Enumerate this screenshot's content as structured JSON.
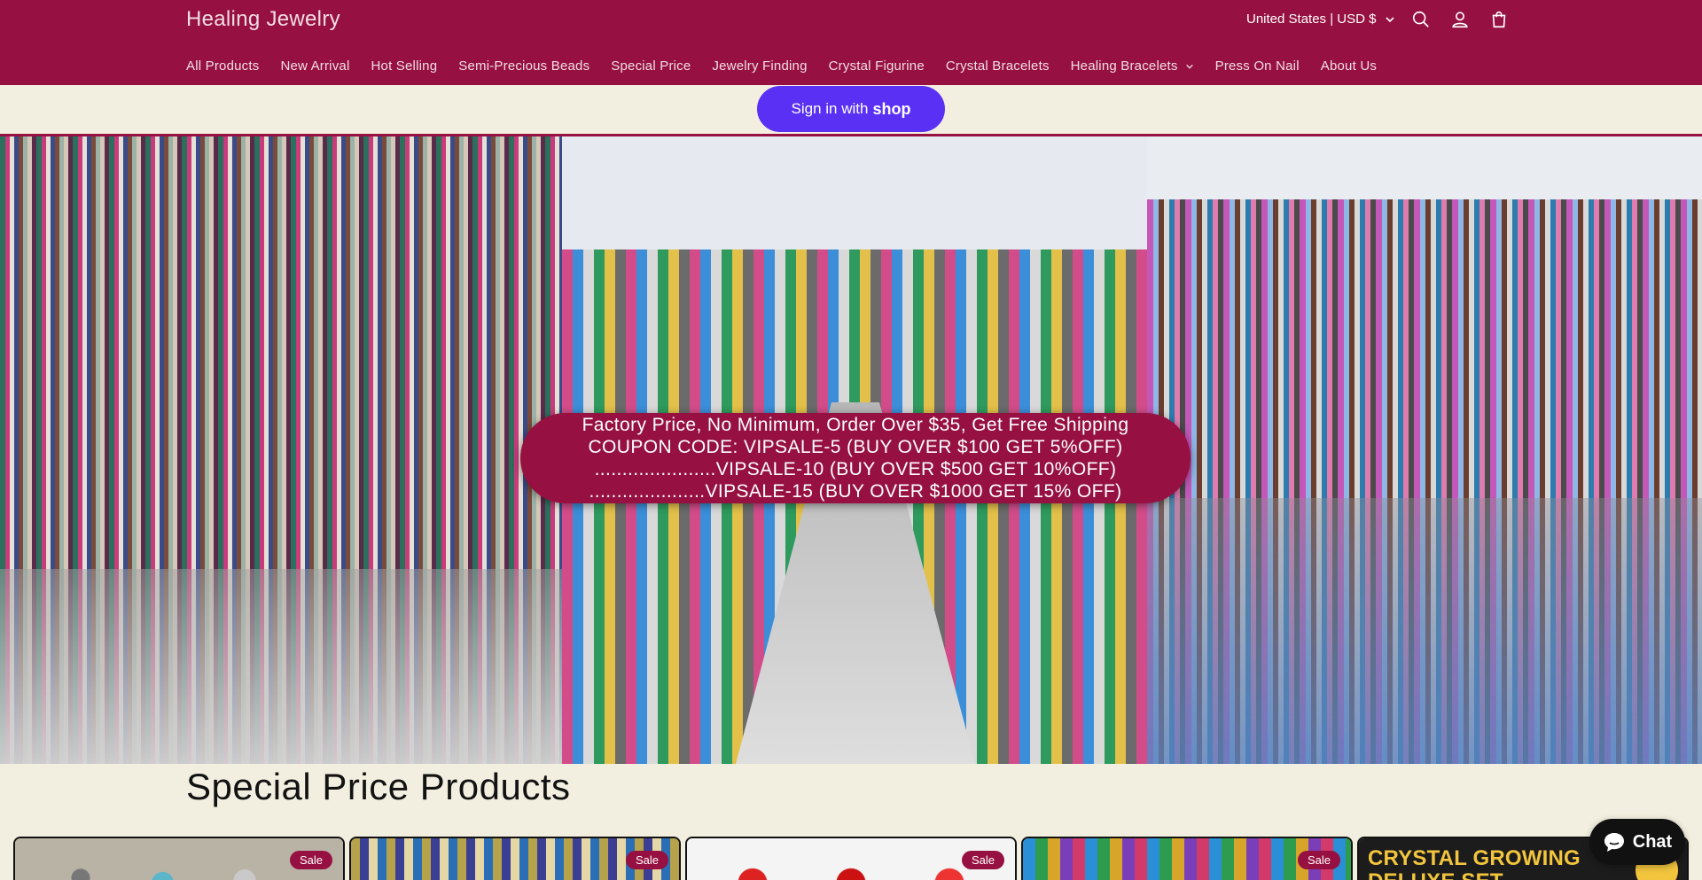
{
  "header": {
    "logo": "Healing Jewelry",
    "country": "United States | USD $",
    "icons": [
      "search-icon",
      "account-icon",
      "cart-icon"
    ],
    "brand_color": "#961142"
  },
  "nav": {
    "items": [
      {
        "label": "All Products"
      },
      {
        "label": "New Arrival"
      },
      {
        "label": "Hot Selling"
      },
      {
        "label": "Semi-Precious Beads"
      },
      {
        "label": "Special Price"
      },
      {
        "label": "Jewelry Finding"
      },
      {
        "label": "Crystal Figurine"
      },
      {
        "label": "Crystal Bracelets"
      },
      {
        "label": "Healing Bracelets",
        "dropdown": true
      },
      {
        "label": "Press On Nail"
      },
      {
        "label": "About Us"
      }
    ]
  },
  "signin": {
    "label": "Sign in with",
    "brand": "shop",
    "color": "#5a31f4"
  },
  "hero": {
    "banner_lines": [
      "Factory Price, No Minimum, Order Over $35, Get Free Shipping",
      "COUPON CODE: VIPSALE-5 (BUY OVER $100 GET 5%OFF)",
      "......................VIPSALE-10 (BUY OVER $500 GET 10%OFF)",
      ".....................VIPSALE-15 (BUY OVER $1000 GET 15% OFF)"
    ]
  },
  "section": {
    "title": "Special Price Products",
    "products": [
      {
        "badge": "Sale"
      },
      {
        "badge": "Sale"
      },
      {
        "badge": "Sale"
      },
      {
        "badge": "Sale"
      },
      {
        "image_text": "CRYSTAL GROWING DELUXE SET"
      }
    ]
  },
  "chat": {
    "label": "Chat"
  }
}
